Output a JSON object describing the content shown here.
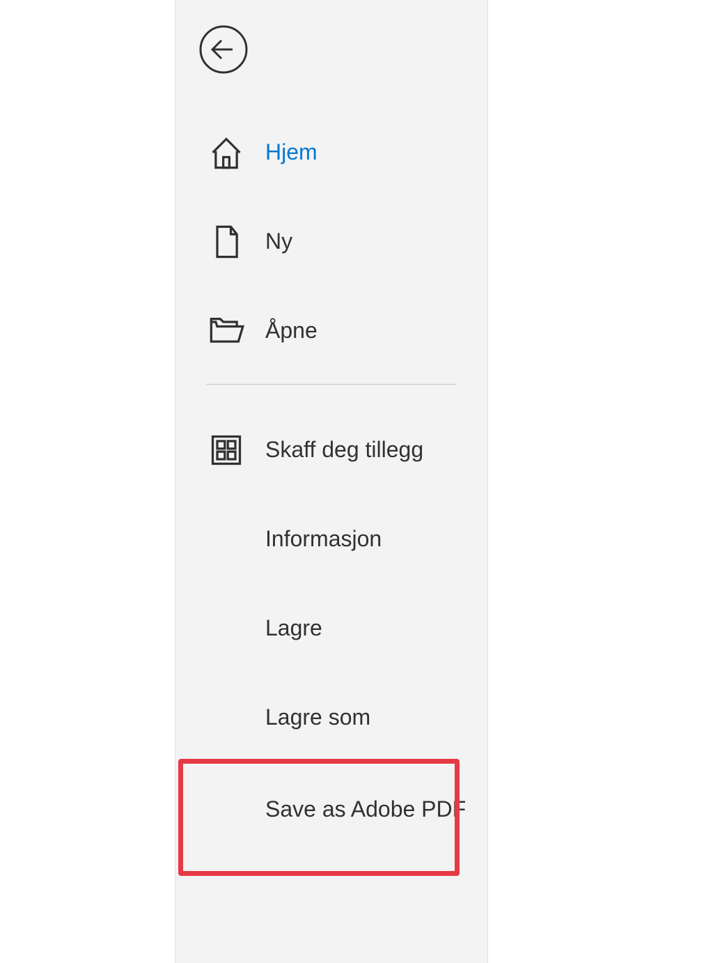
{
  "menu": {
    "items": [
      {
        "label": "Hjem",
        "icon": "home-icon",
        "active": true
      },
      {
        "label": "Ny",
        "icon": "new-file-icon",
        "active": false
      },
      {
        "label": "Åpne",
        "icon": "folder-open-icon",
        "active": false
      }
    ],
    "items2": [
      {
        "label": "Skaff deg tillegg",
        "icon": "addins-icon"
      },
      {
        "label": "Informasjon",
        "icon": null
      },
      {
        "label": "Lagre",
        "icon": null
      },
      {
        "label": "Lagre som",
        "icon": null
      },
      {
        "label": "Save as Adobe PDF",
        "icon": null,
        "highlighted": true
      }
    ]
  }
}
